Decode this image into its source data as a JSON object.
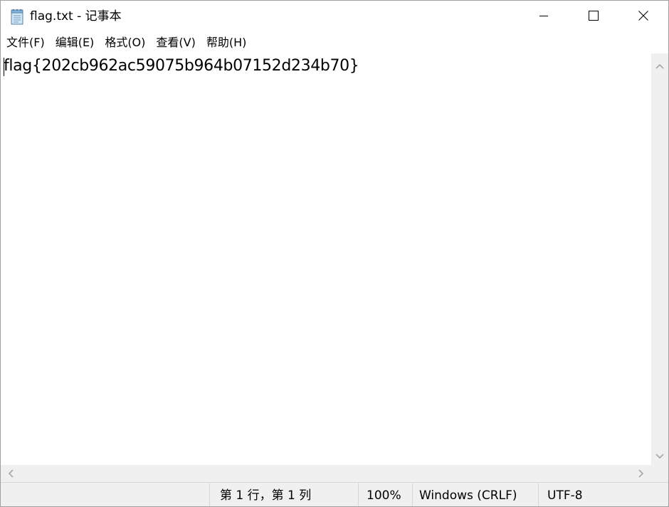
{
  "window": {
    "title": "flag.txt - 记事本",
    "icon": "notepad-icon",
    "controls": {
      "minimize": "minimize-icon",
      "maximize": "maximize-icon",
      "close": "close-icon"
    }
  },
  "menu": {
    "items": [
      {
        "label": "文件(F)"
      },
      {
        "label": "编辑(E)"
      },
      {
        "label": "格式(O)"
      },
      {
        "label": "查看(V)"
      },
      {
        "label": "帮助(H)"
      }
    ]
  },
  "editor": {
    "content": "flag{202cb962ac59075b964b07152d234b70}"
  },
  "statusbar": {
    "position": "第 1 行，第 1 列",
    "zoom": "100%",
    "line_ending": "Windows (CRLF)",
    "encoding": "UTF-8"
  },
  "colors": {
    "window_bg": "#ffffff",
    "chrome_bg": "#f0f0f0",
    "border": "#d7d7d7",
    "text": "#000000",
    "scroll_arrow": "#a6a6a6"
  }
}
